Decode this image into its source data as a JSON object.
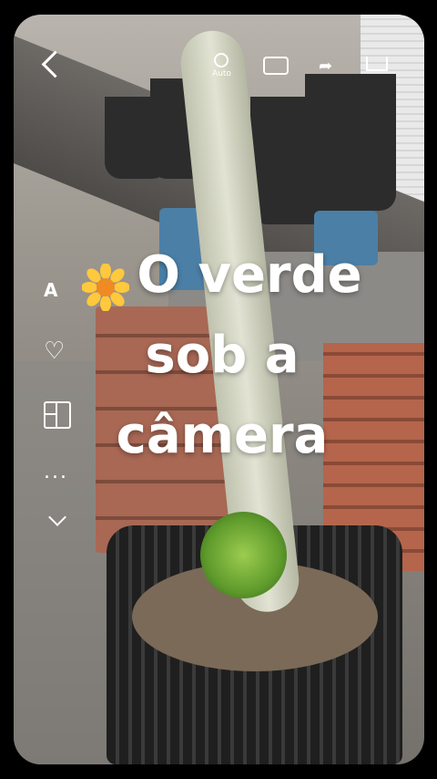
{
  "story": {
    "caption_emoji": "🌼",
    "caption_lines": [
      "O verde",
      "sob a",
      "câmera"
    ]
  },
  "toolbar": {
    "auto_label": "Auto"
  },
  "side_tools": {
    "text_tool_label": "A",
    "more_label": "..."
  },
  "icons": {
    "back": "back-icon",
    "auto": "auto-icon",
    "camera": "camera-icon",
    "share": "share-icon",
    "download": "download-icon",
    "text": "text-icon",
    "heart": "heart-icon",
    "layout": "layout-icon",
    "more": "more-icon",
    "chevron": "chevron-down-icon"
  }
}
